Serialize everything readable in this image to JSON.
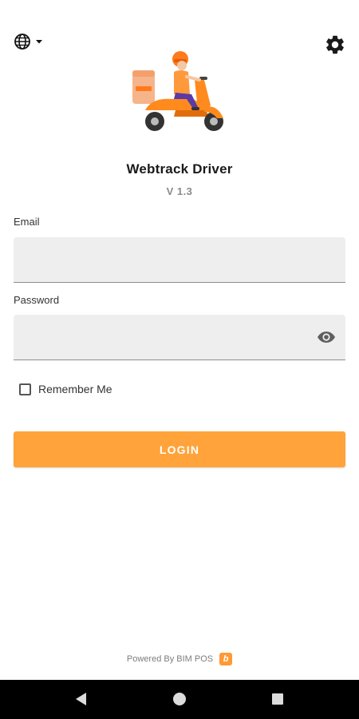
{
  "header": {
    "language_icon": "globe-icon",
    "dropdown_icon": "caret-down-icon",
    "settings_icon": "gear-icon"
  },
  "hero": {
    "illustration": "delivery-scooter-illustration"
  },
  "app": {
    "title": "Webtrack Driver",
    "version": "V 1.3"
  },
  "form": {
    "email_label": "Email",
    "email_value": "",
    "password_label": "Password",
    "password_value": "",
    "password_toggle_icon": "eye-icon",
    "remember_label": "Remember Me",
    "remember_checked": false,
    "login_label": "LOGIN"
  },
  "footer": {
    "powered_text": "Powered By BIM POS",
    "logo_letter": "b"
  },
  "system_nav": {
    "back_icon": "back-triangle-icon",
    "home_icon": "home-circle-icon",
    "recents_icon": "recents-square-icon"
  },
  "colors": {
    "accent": "#ffa33a",
    "field_bg": "#eeeeee",
    "nav_bg": "#000000"
  }
}
